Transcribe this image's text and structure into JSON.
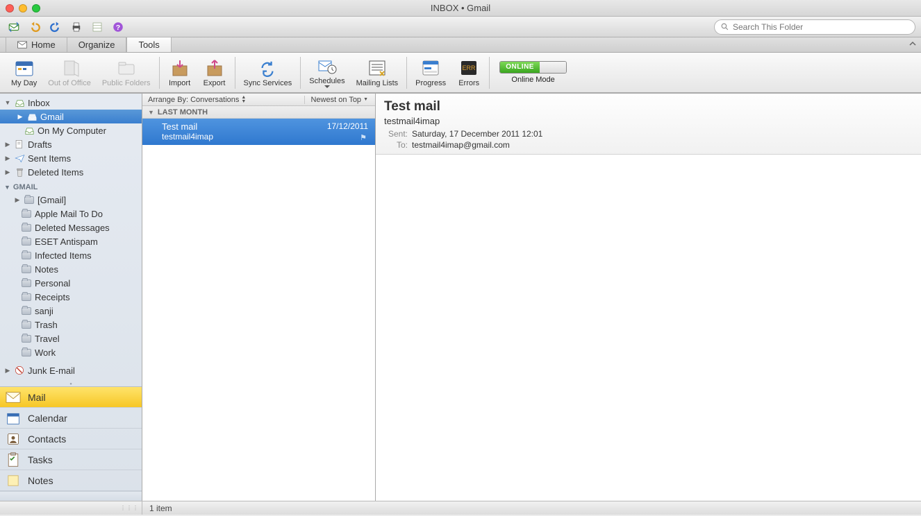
{
  "window": {
    "title": "INBOX • Gmail"
  },
  "search": {
    "placeholder": "Search This Folder"
  },
  "tabs": {
    "home": "Home",
    "organize": "Organize",
    "tools": "Tools"
  },
  "ribbon": {
    "myDay": "My Day",
    "outOfOffice": "Out of Office",
    "publicFolders": "Public Folders",
    "import": "Import",
    "export": "Export",
    "syncServices": "Sync Services",
    "schedules": "Schedules",
    "mailingLists": "Mailing Lists",
    "progress": "Progress",
    "errors": "Errors",
    "onlineBadge": "ONLINE",
    "onlineMode": "Online Mode"
  },
  "sidebar": {
    "inbox": "Inbox",
    "accounts": [
      "Gmail",
      "On My Computer"
    ],
    "drafts": "Drafts",
    "sent": "Sent Items",
    "deleted": "Deleted Items",
    "gmailHeader": "GMAIL",
    "gmailFolders": [
      "[Gmail]",
      "Apple Mail To Do",
      "Deleted Messages",
      "ESET Antispam",
      "Infected Items",
      "Notes",
      "Personal",
      "Receipts",
      "sanji",
      "Trash",
      "Travel",
      "Work"
    ],
    "junk": "Junk E-mail"
  },
  "nav": {
    "mail": "Mail",
    "calendar": "Calendar",
    "contacts": "Contacts",
    "tasks": "Tasks",
    "notes": "Notes"
  },
  "list": {
    "arrangeLabel": "Arrange By:",
    "arrangeValue": "Conversations",
    "sort": "Newest on Top",
    "group": "LAST MONTH",
    "messages": [
      {
        "subject": "Test mail",
        "from": "testmail4imap",
        "date": "17/12/2011"
      }
    ]
  },
  "preview": {
    "subject": "Test mail",
    "from": "testmail4imap",
    "sentLabel": "Sent:",
    "sentValue": "Saturday, 17 December 2011 12:01",
    "toLabel": "To:",
    "toValue": "testmail4imap@gmail.com"
  },
  "status": {
    "text": "1 item"
  }
}
